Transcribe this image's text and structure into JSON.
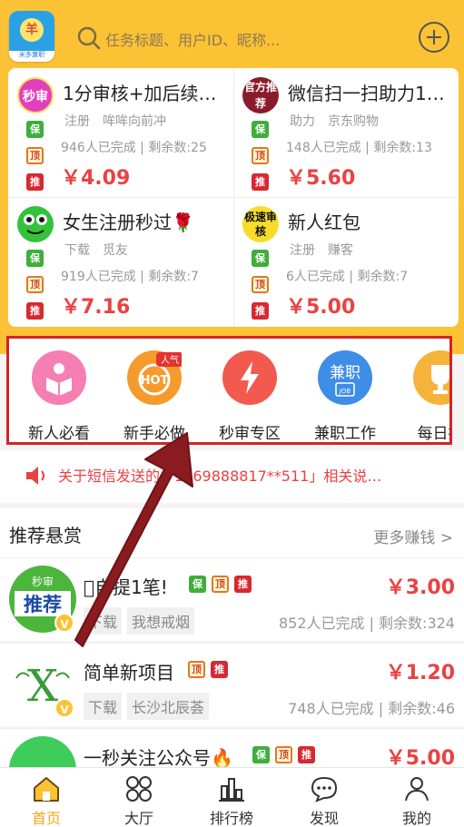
{
  "header": {
    "logo_text": "米多兼职",
    "logo_glyph": "羊",
    "search_placeholder": "任务标题、用户ID、昵称...",
    "add_icon": "plus-circle-icon"
  },
  "top_tasks": [
    {
      "avatar": "秒审",
      "title": "1分审核+加后续…",
      "tag1": "注册",
      "tag2": "哞哞向前冲",
      "stat": "946人已完成 | 剩余数:25",
      "price": "￥4.09"
    },
    {
      "avatar": "官方推荐",
      "title": "微信扫一扫助力1…",
      "tag1": "助力",
      "tag2": "京东购物",
      "stat": "148人已完成 | 剩余数:13",
      "price": "￥5.60"
    },
    {
      "avatar": "",
      "title": "女生注册秒过🌹",
      "tag1": "下载",
      "tag2": "觅友",
      "stat": "919人已完成 | 剩余数:7",
      "price": "￥7.16"
    },
    {
      "avatar": "极速审核",
      "title": "新人红包",
      "tag1": "注册",
      "tag2": "赚客",
      "stat": "6人已完成 | 剩余数:7",
      "price": "￥5.00"
    }
  ],
  "badges": {
    "bao": "保",
    "ding": "顶",
    "tui": "推",
    "v": "V"
  },
  "quick_icons": [
    {
      "label": "新人必看",
      "color": "#f57eb3"
    },
    {
      "label": "新手必做",
      "color": "#f79a2c",
      "text": "HOT",
      "tag": "人气"
    },
    {
      "label": "秒审专区",
      "color": "#f25a4f"
    },
    {
      "label": "兼职工作",
      "color": "#3e8de6",
      "text": "兼职",
      "sub": "JOB"
    },
    {
      "label": "每日播",
      "color": "#f6b33c"
    }
  ],
  "notice": {
    "text": "关于短信发送的「1069888817**511」相关说…"
  },
  "recommend": {
    "title": "推荐悬赏",
    "more": "更多赚钱 >",
    "items": [
      {
        "thumb": "推荐",
        "thumb_top": "秒审",
        "name": "\u0000自提1笔!",
        "price": "￥3.00",
        "chip1": "下载",
        "chip2": "我想戒烟",
        "meta": "852人已完成 | 剩余数:324"
      },
      {
        "thumb": "X",
        "name": "简单新项目",
        "price": "￥1.20",
        "chip1": "下载",
        "chip2": "长沙北辰荟",
        "meta": "748人已完成 | 剩余数:46"
      },
      {
        "thumb": "",
        "name": "一秒关注公众号🔥",
        "price": "￥5.00"
      }
    ]
  },
  "tabs": [
    {
      "label": "首页",
      "icon": "home-icon"
    },
    {
      "label": "大厅",
      "icon": "grid-icon"
    },
    {
      "label": "排行榜",
      "icon": "bar-chart-icon"
    },
    {
      "label": "发现",
      "icon": "chat-bubble-icon"
    },
    {
      "label": "我的",
      "icon": "user-icon"
    }
  ]
}
